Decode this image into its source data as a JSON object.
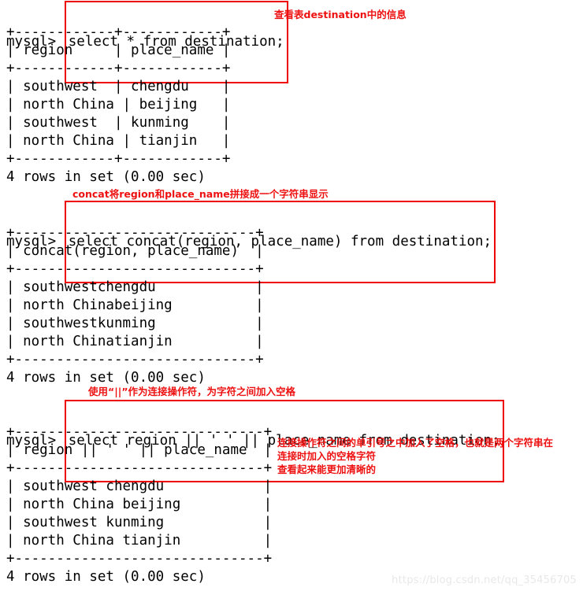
{
  "terminal": {
    "prompt": "mysql> ",
    "blocks": [
      {
        "id": "block1",
        "command": "select * from destination;",
        "annotation": "查看表destination中的信息",
        "result_lines": [
          "+------------+------------+",
          "| region     | place_name |",
          "+------------+------------+",
          "| southwest  | chengdu    |",
          "| north China | beijing   |",
          "| southwest  | kunming    |",
          "| north China | tianjin   |",
          "+------------+------------+",
          "4 rows in set (0.00 sec)"
        ],
        "table": {
          "separator": "+------------+------------+",
          "headers": [
            "region",
            "place_name"
          ],
          "rows": [
            [
              "southwest",
              "chengdu"
            ],
            [
              "north China",
              "beijing"
            ],
            [
              "southwest",
              "kunming"
            ],
            [
              "north China",
              "tianjin"
            ]
          ]
        },
        "status": "4 rows in set (0.00 sec)"
      },
      {
        "id": "block2",
        "command": "select concat(region, place_name) from destination;",
        "annotation": "concat将region和place_name拼接成一个字符串显示",
        "table": {
          "separator": "+-----------------------------+",
          "headers": [
            "concat(region, place_name)"
          ],
          "rows": [
            [
              "southwestchengdu"
            ],
            [
              "north Chinabeijing"
            ],
            [
              "southwestkunming"
            ],
            [
              "north Chinatianjin"
            ]
          ]
        },
        "status": "4 rows in set (0.00 sec)"
      },
      {
        "id": "block3",
        "command": "select region || ' ' || place_name from destination;",
        "annotation": "使用“||”作为连接操作符，为字符之间加入空格",
        "side_annotation": "连接操作符之间的单引号之中加入了空格，也就是两个字符串在\n连接时加入的空格字符\n查看起来能更加清晰的",
        "table": {
          "separator": "+------------------------------+",
          "headers": [
            "region || ' ' || place_name"
          ],
          "rows": [
            [
              "southwest chengdu"
            ],
            [
              "north China beijing"
            ],
            [
              "southwest kunming"
            ],
            [
              "north China tianjin"
            ]
          ]
        },
        "status": "4 rows in set (0.00 sec)"
      }
    ],
    "lines": {
      "b1_sep_top": "+------------+------------+",
      "b1_header": "| region     | place_name |",
      "b1_sep_mid": "+------------+------------+",
      "b1_row1": "| southwest  | chengdu    |",
      "b1_row2": "| north China | beijing   |",
      "b1_row3": "| southwest  | kunming    |",
      "b1_row4": "| north China | tianjin   |",
      "b1_sep_bot": "+------------+------------+",
      "b1_status": "4 rows in set (0.00 sec)",
      "b2_sep_top": "+-----------------------------+",
      "b2_header": "| concat(region, place_name)  |",
      "b2_sep_mid": "+-----------------------------+",
      "b2_row1": "| southwestchengdu            |",
      "b2_row2": "| north Chinabeijing          |",
      "b2_row3": "| southwestkunming            |",
      "b2_row4": "| north Chinatianjin          |",
      "b2_sep_bot": "+-----------------------------+",
      "b2_status": "4 rows in set (0.00 sec)",
      "b3_sep_top": "+------------------------------+",
      "b3_header": "| region || ' ' || place_name  |",
      "b3_sep_mid": "+------------------------------+",
      "b3_row1": "| southwest chengdu            |",
      "b3_row2": "| north China beijing          |",
      "b3_row3": "| southwest kunming            |",
      "b3_row4": "| north China tianjin          |",
      "b3_sep_bot": "+------------------------------+",
      "b3_status": "4 rows in set (0.00 sec)"
    }
  },
  "annotations": {
    "a1": "查看表destination中的信息",
    "a2": "concat将region和place_name拼接成一个字符串显示",
    "a3": "使用“||”作为连接操作符，为字符之间加入空格",
    "a4_line1": "连接操作符之间的单引号之中加入了空格，也就是两个字符串在",
    "a4_line2": "连接时加入的空格字符",
    "a4_line3": "查看起来能更加清晰的"
  },
  "watermark": "https://blog.csdn.net/qq_35456705",
  "colors": {
    "annotation_red": "#ee1111",
    "box_red": "#ee0000",
    "text_black": "#000000",
    "background": "#ffffff",
    "watermark_gray": "#e8e8e8"
  }
}
